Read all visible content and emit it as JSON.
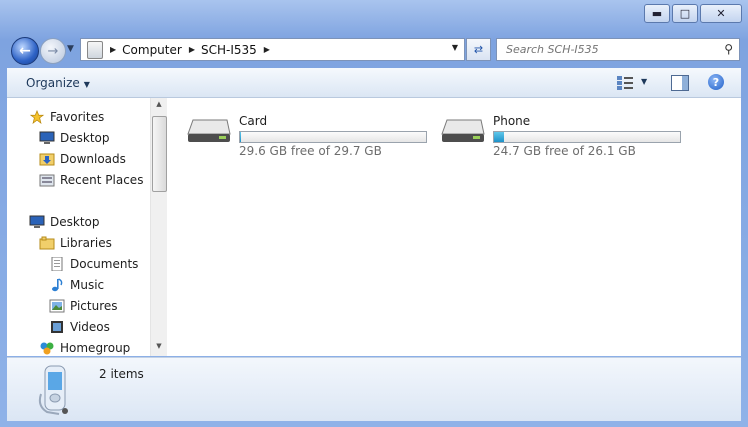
{
  "window": {
    "minimize_icon": "minimize-icon",
    "maximize_icon": "maximize-icon",
    "close_icon": "close-icon"
  },
  "address": {
    "crumbs": [
      "Computer",
      "SCH-I535"
    ]
  },
  "search": {
    "placeholder": "Search SCH-I535"
  },
  "toolbar": {
    "organize_label": "Organize"
  },
  "sidebar": {
    "favorites": {
      "label": "Favorites",
      "items": [
        {
          "label": "Desktop",
          "icon": "desktop-icon"
        },
        {
          "label": "Downloads",
          "icon": "downloads-folder-icon"
        },
        {
          "label": "Recent Places",
          "icon": "recent-places-icon"
        }
      ]
    },
    "desktop_label": "Desktop",
    "libraries": {
      "label": "Libraries",
      "items": [
        {
          "label": "Documents",
          "icon": "documents-icon"
        },
        {
          "label": "Music",
          "icon": "music-icon"
        },
        {
          "label": "Pictures",
          "icon": "pictures-icon"
        },
        {
          "label": "Videos",
          "icon": "videos-icon"
        }
      ]
    },
    "homegroup_label": "Homegroup"
  },
  "drives": [
    {
      "name": "Card",
      "free_text": "29.6 GB free of 29.7 GB",
      "used_fraction": 0.003
    },
    {
      "name": "Phone",
      "free_text": "24.7 GB free of 26.1 GB",
      "used_fraction": 0.054
    }
  ],
  "details": {
    "count": "2 items"
  },
  "colors": {
    "accent": "#1d92c9",
    "frame": "#7ea3e0"
  }
}
